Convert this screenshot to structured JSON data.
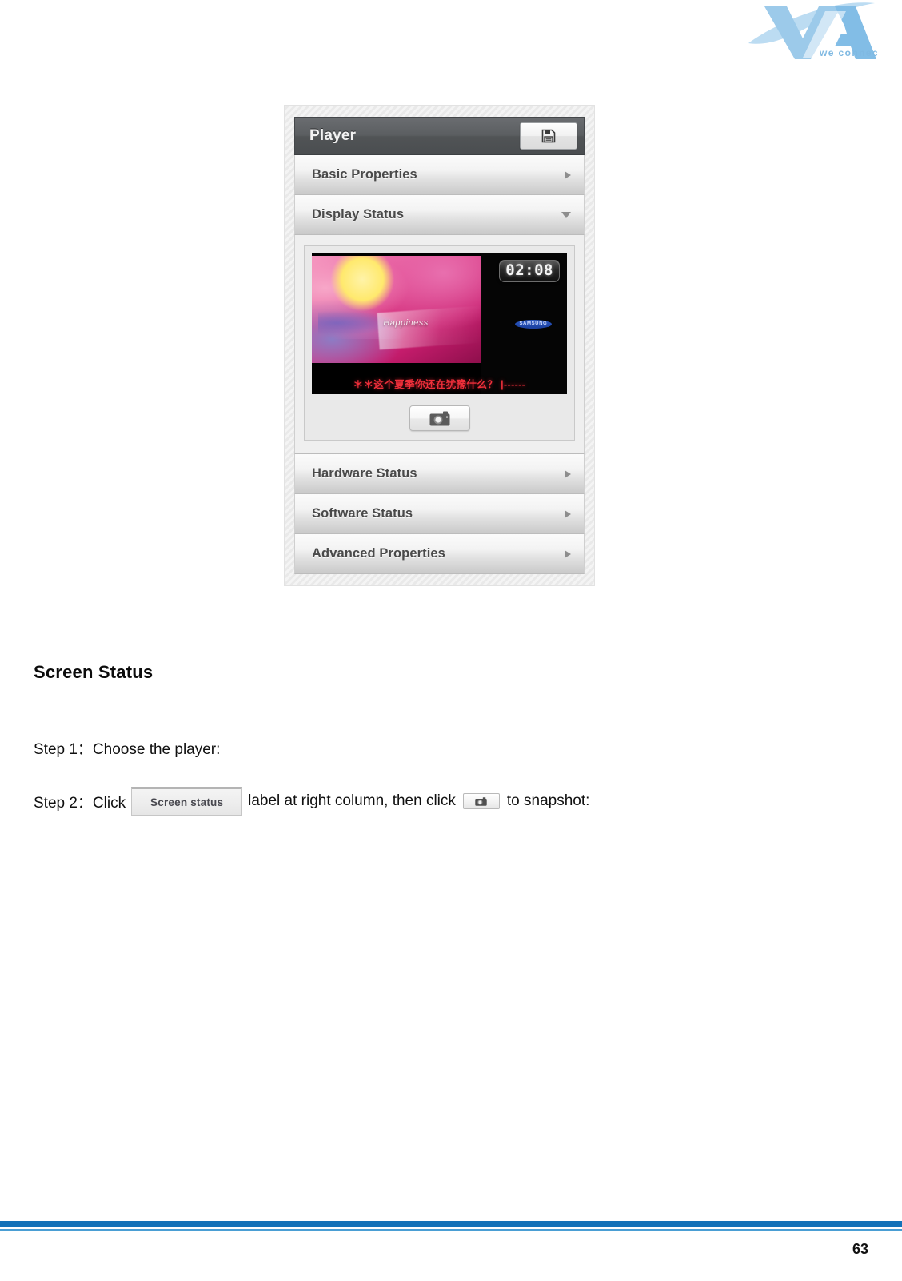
{
  "document": {
    "page_number": "63",
    "brand": {
      "name": "VIA",
      "tagline": "we connect",
      "logo_color": "#8dc3e8",
      "accent_color": "#1371b8"
    }
  },
  "figure": {
    "panel": {
      "title": "Player",
      "save_button_icon": "floppy-disk-icon",
      "sections": [
        {
          "label": "Basic Properties",
          "state": "collapsed",
          "indicator": "triangle-right"
        },
        {
          "label": "Display Status",
          "state": "expanded",
          "indicator": "triangle-down"
        },
        {
          "label": "Hardware Status",
          "state": "collapsed",
          "indicator": "triangle-right"
        },
        {
          "label": "Software Status",
          "state": "collapsed",
          "indicator": "triangle-right"
        },
        {
          "label": "Advanced Properties",
          "state": "collapsed",
          "indicator": "triangle-right"
        }
      ],
      "display_status": {
        "preview": {
          "clock_time": "02:08",
          "brand_overlay": "SAMSUNG",
          "artwork_caption": "Happiness",
          "subtitle_text": "＊＊这个夏季你还在犹豫什么？ |------"
        },
        "snapshot_button_icon": "camera-icon"
      }
    }
  },
  "content": {
    "heading": "Screen Status",
    "step1": "Step 1：Choose the player:",
    "step2": {
      "prefix": "Step 2：Click",
      "button_label": "Screen status",
      "middle": "label at right column, then click",
      "camera_icon": "camera-icon",
      "suffix": "to snapshot:"
    }
  }
}
